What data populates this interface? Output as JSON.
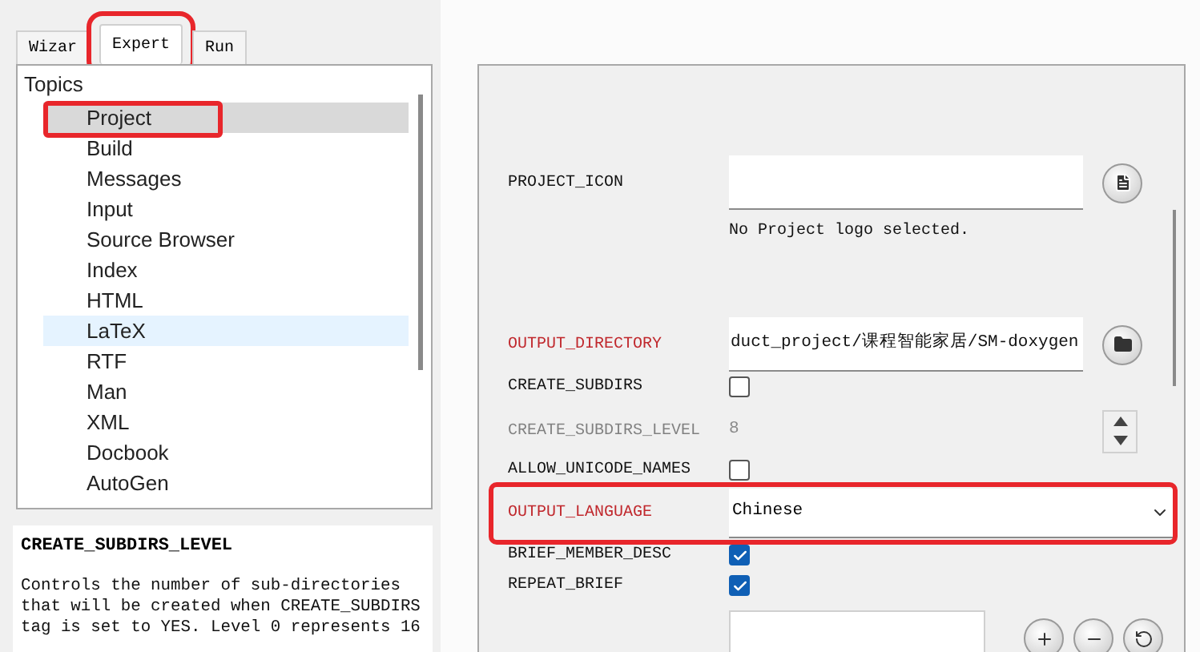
{
  "tabs": [
    {
      "label": "Wizar",
      "selected": false,
      "highlighted": false
    },
    {
      "label": "Expert",
      "selected": true,
      "highlighted": true
    },
    {
      "label": "Run",
      "selected": false,
      "highlighted": false
    }
  ],
  "topics": {
    "label": "Topics",
    "children": [
      {
        "label": "Project",
        "selected": true,
        "hovered": false,
        "highlighted": true
      },
      {
        "label": "Build",
        "selected": false,
        "hovered": false,
        "highlighted": false
      },
      {
        "label": "Messages",
        "selected": false,
        "hovered": false,
        "highlighted": false
      },
      {
        "label": "Input",
        "selected": false,
        "hovered": false,
        "highlighted": false
      },
      {
        "label": "Source Browser",
        "selected": false,
        "hovered": false,
        "highlighted": false
      },
      {
        "label": "Index",
        "selected": false,
        "hovered": false,
        "highlighted": false
      },
      {
        "label": "HTML",
        "selected": false,
        "hovered": false,
        "highlighted": false
      },
      {
        "label": "LaTeX",
        "selected": false,
        "hovered": true,
        "highlighted": false
      },
      {
        "label": "RTF",
        "selected": false,
        "hovered": false,
        "highlighted": false
      },
      {
        "label": "Man",
        "selected": false,
        "hovered": false,
        "highlighted": false
      },
      {
        "label": "XML",
        "selected": false,
        "hovered": false,
        "highlighted": false
      },
      {
        "label": "Docbook",
        "selected": false,
        "hovered": false,
        "highlighted": false
      },
      {
        "label": "AutoGen",
        "selected": false,
        "hovered": false,
        "highlighted": false
      }
    ]
  },
  "help": {
    "title": "CREATE_SUBDIRS_LEVEL",
    "text": "Controls the number of sub-directories\nthat will be created when CREATE_SUBDIRS\ntag is set to YES. Level 0 represents 16"
  },
  "settings": [
    {
      "kind": "file",
      "label": "PROJECT_ICON",
      "changed": false,
      "disabled": false,
      "highlighted": false,
      "note": "No Project logo selected."
    },
    {
      "kind": "folder",
      "label": "OUTPUT_DIRECTORY",
      "changed": true,
      "disabled": false,
      "highlighted": false,
      "value": "duct_project/课程智能家居/SM-doxygen"
    },
    {
      "kind": "checkbox",
      "label": "CREATE_SUBDIRS",
      "changed": false,
      "disabled": false,
      "highlighted": false,
      "checked": false
    },
    {
      "kind": "spinner",
      "label": "CREATE_SUBDIRS_LEVEL",
      "changed": false,
      "disabled": true,
      "highlighted": false,
      "value": "8"
    },
    {
      "kind": "checkbox",
      "label": "ALLOW_UNICODE_NAMES",
      "changed": false,
      "disabled": false,
      "highlighted": false,
      "checked": false
    },
    {
      "kind": "dropdown",
      "label": "OUTPUT_LANGUAGE",
      "changed": true,
      "disabled": false,
      "highlighted": true,
      "value": "Chinese"
    },
    {
      "kind": "checkbox",
      "label": "BRIEF_MEMBER_DESC",
      "changed": false,
      "disabled": false,
      "highlighted": false,
      "checked": true
    },
    {
      "kind": "checkbox",
      "label": "REPEAT_BRIEF",
      "changed": false,
      "disabled": false,
      "highlighted": false,
      "checked": true
    },
    {
      "kind": "list",
      "highlighted": false
    }
  ]
}
